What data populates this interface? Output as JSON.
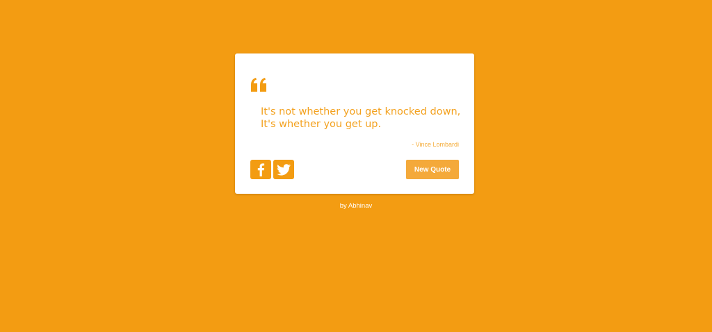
{
  "colors": {
    "background": "#f39c12",
    "card": "#ffffff",
    "accent": "#f39c12",
    "button": "#f4a93a"
  },
  "quote": {
    "icon": "quote-left-icon",
    "lines": [
      "It's not whether you get knocked down,",
      "It's whether you get up."
    ],
    "author": "- Vince Lombardi"
  },
  "share": {
    "facebook_icon": "facebook-icon",
    "twitter_icon": "twitter-icon"
  },
  "actions": {
    "new_quote_label": "New Quote"
  },
  "footer": {
    "credit": "by Abhinav"
  }
}
